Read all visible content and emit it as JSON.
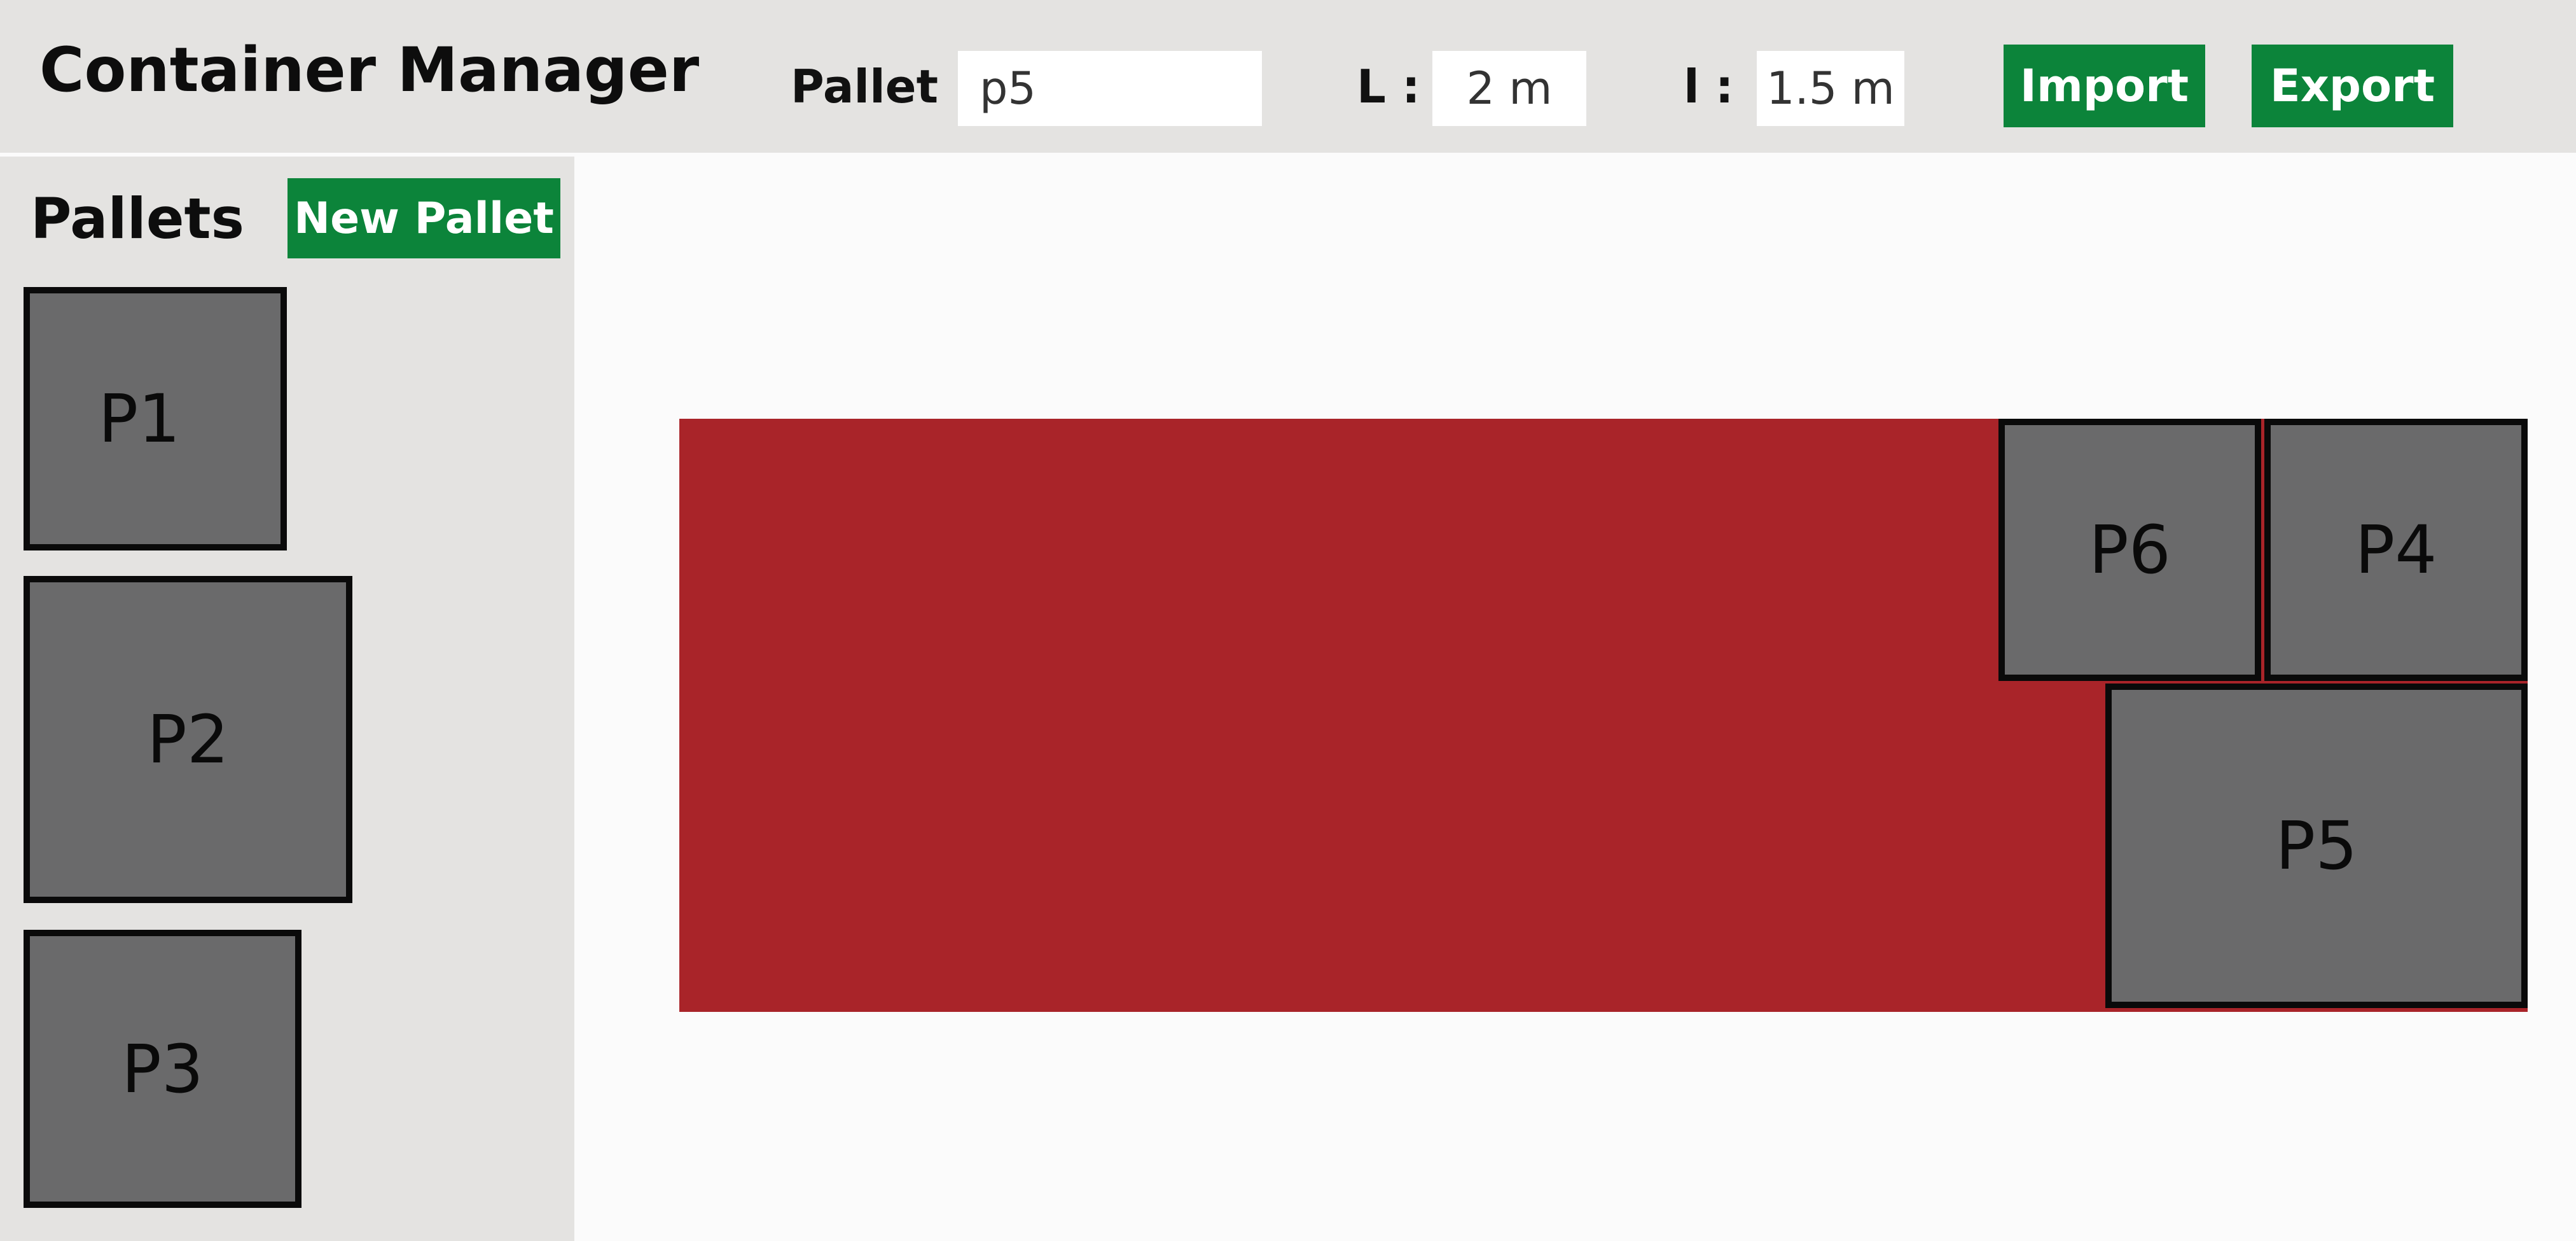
{
  "header": {
    "title": "Container Manager",
    "pallet_label": "Pallet :",
    "pallet_value": "p5",
    "length_label": "L :",
    "length_value": "2 m",
    "width_label": "l :",
    "width_value": "1.5 m",
    "import_label": "Import",
    "export_label": "Export"
  },
  "sidebar": {
    "title": "Pallets",
    "new_pallet_label": "New Pallet",
    "pallets": [
      {
        "label": "P1"
      },
      {
        "label": "P2"
      },
      {
        "label": "P3"
      }
    ]
  },
  "container": {
    "color": "#a92429",
    "pallets": [
      {
        "label": "P6"
      },
      {
        "label": "P4"
      },
      {
        "label": "P5"
      }
    ]
  },
  "colors": {
    "accent": "#0c843a",
    "pallet_fill": "#6a6a6b",
    "panel_bg": "#e4e3e1"
  }
}
